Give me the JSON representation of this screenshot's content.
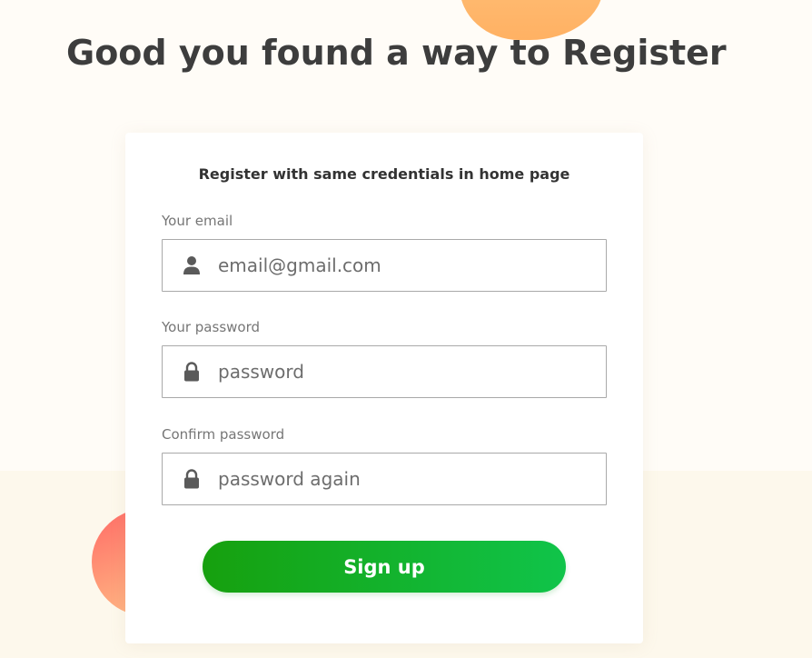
{
  "page": {
    "title": "Good you found a way to Register"
  },
  "form": {
    "heading": "Register with same credentials in home page",
    "email": {
      "label": "Your email",
      "placeholder": "email@gmail.com",
      "icon": "user-icon"
    },
    "password": {
      "label": "Your password",
      "placeholder": "password",
      "icon": "lock-icon"
    },
    "confirm": {
      "label": "Confirm password",
      "placeholder": "password again",
      "icon": "lock-icon"
    },
    "submit_label": "Sign up"
  },
  "colors": {
    "button_start": "#16a00e",
    "button_end": "#10c44a",
    "blob_top": "#ffb163",
    "blob_bottom": "#ff6a66",
    "text": "#3d3d3d"
  }
}
